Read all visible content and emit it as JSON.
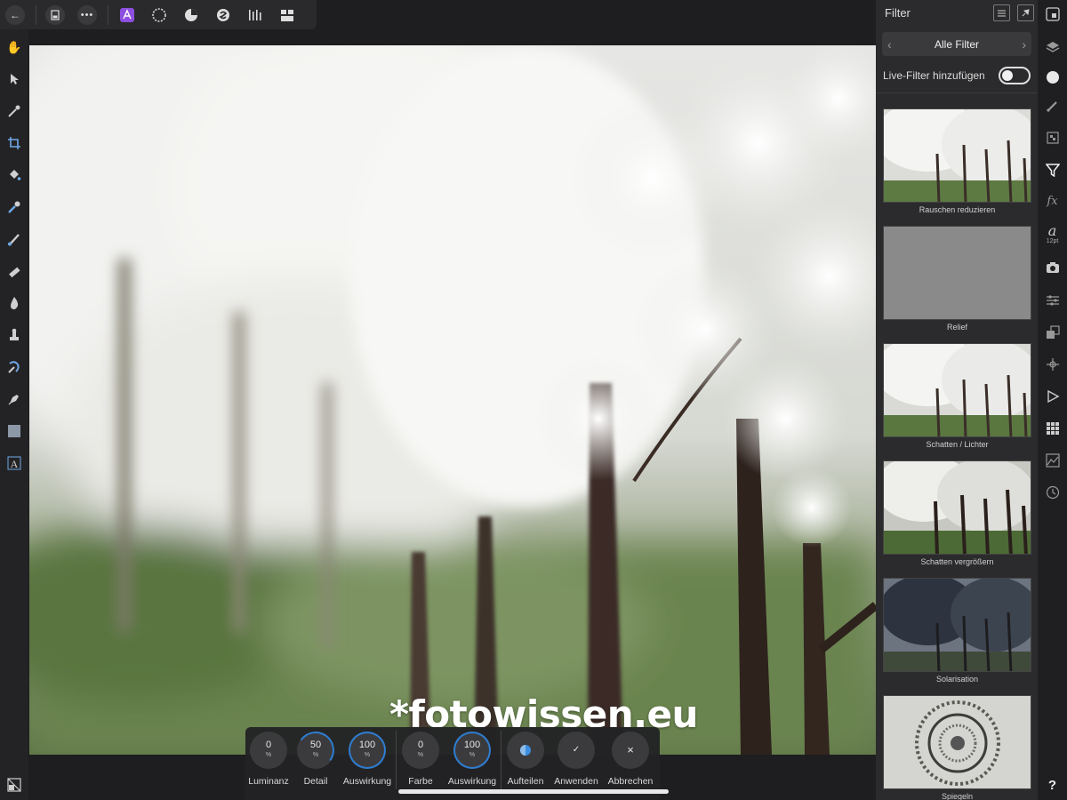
{
  "toolbar": {
    "back_icon": "back-arrow-icon",
    "document_icon": "document-icon",
    "more_icon": "more-icon",
    "personas": [
      "photo-persona-icon",
      "liquify-persona-icon",
      "develop-persona-icon",
      "tone-mapping-persona-icon",
      "export-persona-icon"
    ],
    "view_icon": "view-mode-icon"
  },
  "tools": [
    "hand-icon",
    "move-icon",
    "color-picker-icon",
    "crop-icon",
    "fill-icon",
    "selection-brush-icon",
    "paint-brush-icon",
    "erase-brush-icon",
    "burn-icon",
    "clone-icon",
    "retouch-icon",
    "pen-icon",
    "rectangle-icon",
    "text-icon"
  ],
  "canvas": {
    "watermark": "*fotowissen.eu"
  },
  "context_toolbar": {
    "dials": [
      {
        "value": "0",
        "unit": "%",
        "label": "Luminanz",
        "progress": 0
      },
      {
        "value": "50",
        "unit": "%",
        "label": "Detail",
        "progress": 0.5
      },
      {
        "value": "100",
        "unit": "%",
        "label": "Auswirkung",
        "progress": 1
      },
      {
        "value": "0",
        "unit": "%",
        "label": "Farbe",
        "progress": 0
      },
      {
        "value": "100",
        "unit": "%",
        "label": "Auswirkung",
        "progress": 1
      }
    ],
    "actions": [
      {
        "label": "Aufteilen",
        "icon": "split-icon"
      },
      {
        "label": "Anwenden",
        "icon": "check-icon",
        "glyph": "✓"
      },
      {
        "label": "Abbrechen",
        "icon": "close-icon",
        "glyph": "×"
      }
    ]
  },
  "filter_panel": {
    "title": "Filter",
    "category": "Alle Filter",
    "live_filter_label": "Live-Filter hinzufügen",
    "live_filter_on": false,
    "filters": [
      {
        "label": "Rauschen reduzieren",
        "style": "normal"
      },
      {
        "label": "Relief",
        "style": "relief"
      },
      {
        "label": "Schatten / Lichter",
        "style": "normal"
      },
      {
        "label": "Schatten vergrößern",
        "style": "shadow"
      },
      {
        "label": "Solarisation",
        "style": "solarize"
      },
      {
        "label": "Spiegeln",
        "style": "mirror"
      }
    ]
  },
  "studio": {
    "icons": [
      "navigator-icon",
      "layers-icon",
      "color-icon",
      "brushes-icon",
      "channels-icon",
      "filter-icon",
      "effects-icon",
      "character-icon",
      "stock-icon",
      "adjustments-icon",
      "transform-icon",
      "snapping-icon",
      "macros-icon",
      "library-icon",
      "histogram-icon",
      "history-icon",
      "help-icon"
    ],
    "character_size": "12pt",
    "help_glyph": "?"
  },
  "colors": {
    "accent": "#2e7dd1",
    "panel": "#2b2b2d",
    "persona_active": "#8e4fe0"
  }
}
